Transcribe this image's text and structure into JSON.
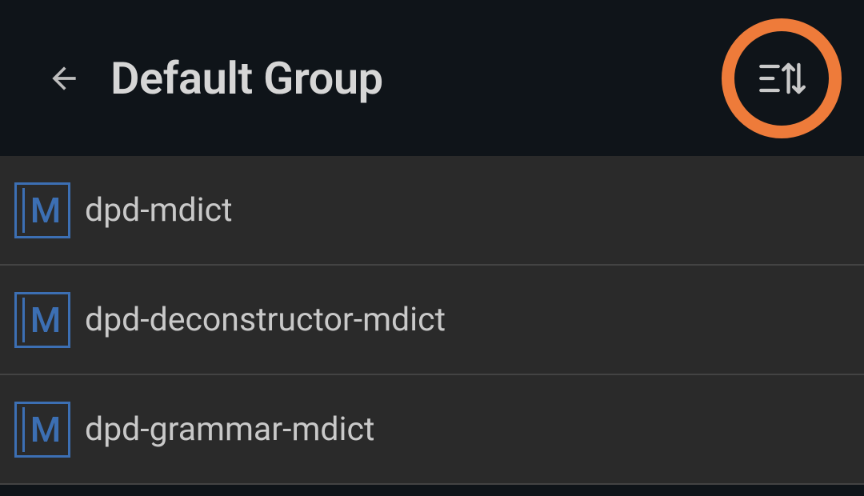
{
  "header": {
    "title": "Default Group"
  },
  "list": {
    "items": [
      {
        "label": "dpd-mdict",
        "icon_letter": "M"
      },
      {
        "label": "dpd-deconstructor-mdict",
        "icon_letter": "M"
      },
      {
        "label": "dpd-grammar-mdict",
        "icon_letter": "M"
      }
    ]
  },
  "highlight_color": "#ee7b3a"
}
